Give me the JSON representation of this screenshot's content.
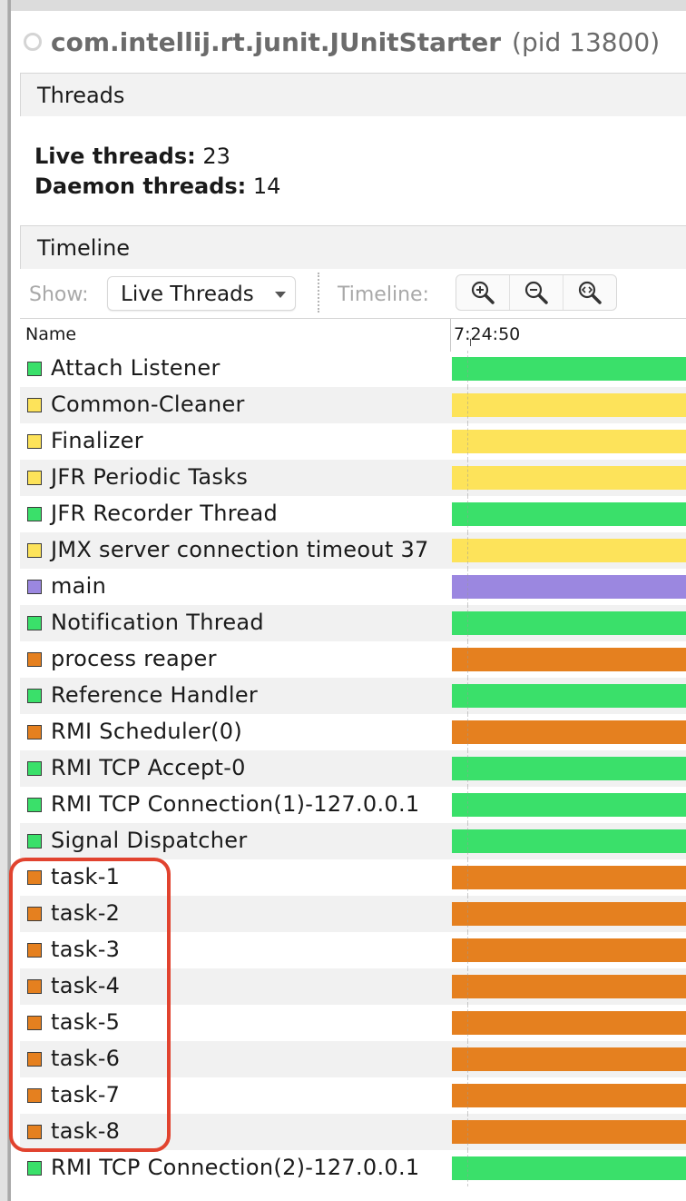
{
  "app": {
    "title": "com.intellij.rt.junit.JUnitStarter",
    "pid": "(pid 13800)"
  },
  "threads_section": {
    "header": "Threads",
    "live_label": "Live threads:",
    "live_value": "23",
    "daemon_label": "Daemon threads:",
    "daemon_value": "14"
  },
  "timeline_section": {
    "header": "Timeline",
    "show_label": "Show:",
    "show_value": "Live Threads",
    "timeline_label": "Timeline:",
    "zoom_buttons": [
      "zoom-in-icon",
      "zoom-out-icon",
      "zoom-fit-icon"
    ]
  },
  "table": {
    "name_header": "Name",
    "time_header": "7:24:50"
  },
  "colors": {
    "running": "#3ae06a",
    "sleeping": "#fde35a",
    "waiting": "#e5801f",
    "monitor": "#9b87e0",
    "highlight": "#e1432f"
  },
  "threads": [
    {
      "name": "Attach Listener",
      "state": "running"
    },
    {
      "name": "Common-Cleaner",
      "state": "sleeping"
    },
    {
      "name": "Finalizer",
      "state": "sleeping"
    },
    {
      "name": "JFR Periodic Tasks",
      "state": "sleeping"
    },
    {
      "name": "JFR Recorder Thread",
      "state": "running"
    },
    {
      "name": "JMX server connection timeout 37",
      "state": "sleeping"
    },
    {
      "name": "main",
      "state": "monitor"
    },
    {
      "name": "Notification Thread",
      "state": "running"
    },
    {
      "name": "process reaper",
      "state": "waiting"
    },
    {
      "name": "Reference Handler",
      "state": "running"
    },
    {
      "name": "RMI Scheduler(0)",
      "state": "waiting"
    },
    {
      "name": "RMI TCP Accept-0",
      "state": "running"
    },
    {
      "name": "RMI TCP Connection(1)-127.0.0.1",
      "state": "running"
    },
    {
      "name": "Signal Dispatcher",
      "state": "running"
    },
    {
      "name": "task-1",
      "state": "waiting"
    },
    {
      "name": "task-2",
      "state": "waiting"
    },
    {
      "name": "task-3",
      "state": "waiting"
    },
    {
      "name": "task-4",
      "state": "waiting"
    },
    {
      "name": "task-5",
      "state": "waiting"
    },
    {
      "name": "task-6",
      "state": "waiting"
    },
    {
      "name": "task-7",
      "state": "waiting"
    },
    {
      "name": "task-8",
      "state": "waiting"
    },
    {
      "name": "RMI TCP Connection(2)-127.0.0.1",
      "state": "running"
    }
  ]
}
